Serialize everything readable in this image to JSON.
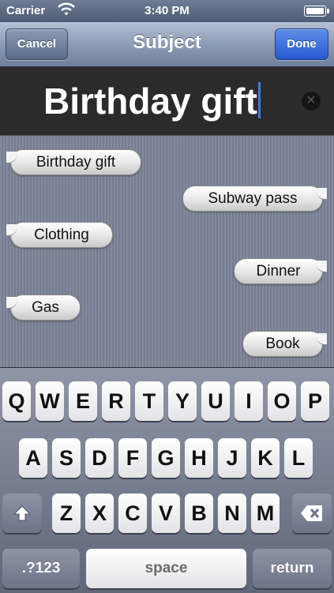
{
  "status_bar": {
    "carrier": "Carrier",
    "time": "3:40 PM"
  },
  "nav_bar": {
    "cancel_label": "Cancel",
    "title": "Subject",
    "done_label": "Done"
  },
  "text_field": {
    "value": "Birthday gift"
  },
  "suggestions": [
    "Birthday gift",
    "Subway pass",
    "Clothing",
    "Dinner",
    "Gas",
    "Book"
  ],
  "keyboard": {
    "row1": [
      "Q",
      "W",
      "E",
      "R",
      "T",
      "Y",
      "U",
      "I",
      "O",
      "P"
    ],
    "row2": [
      "A",
      "S",
      "D",
      "F",
      "G",
      "H",
      "J",
      "K",
      "L"
    ],
    "row3": [
      "Z",
      "X",
      "C",
      "V",
      "B",
      "N",
      "M"
    ],
    "numbers_label": ".?123",
    "space_label": "space",
    "return_label": "return",
    "shift_icon": "shift-icon",
    "delete_icon": "backspace-icon"
  },
  "colors": {
    "done_button": "#2659d1",
    "cursor": "#3d7bdc"
  }
}
